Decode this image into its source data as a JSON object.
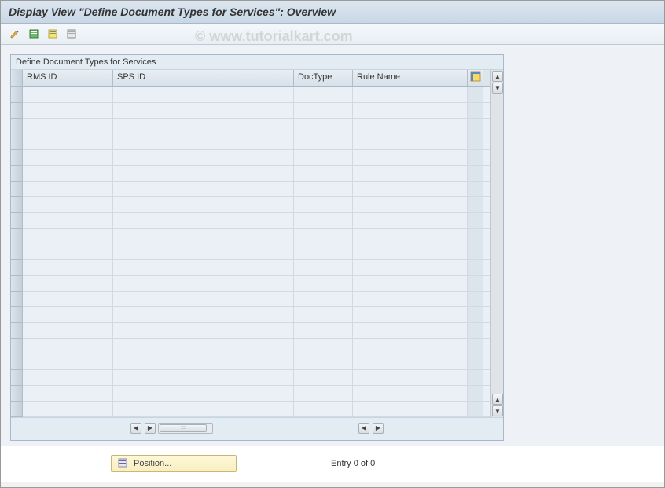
{
  "window": {
    "title": "Display View \"Define Document Types for Services\": Overview"
  },
  "toolbar": {
    "icons": [
      "change-icon",
      "select-all-icon",
      "select-block-icon",
      "deselect-icon"
    ]
  },
  "panel": {
    "title": "Define Document Types for Services",
    "columns": {
      "rms": "RMS ID",
      "sps": "SPS ID",
      "doctype": "DocType",
      "rule": "Rule Name"
    },
    "rows": []
  },
  "footer": {
    "position_label": "Position...",
    "entry_text": "Entry 0 of 0"
  },
  "watermark": "© www.tutorialkart.com"
}
